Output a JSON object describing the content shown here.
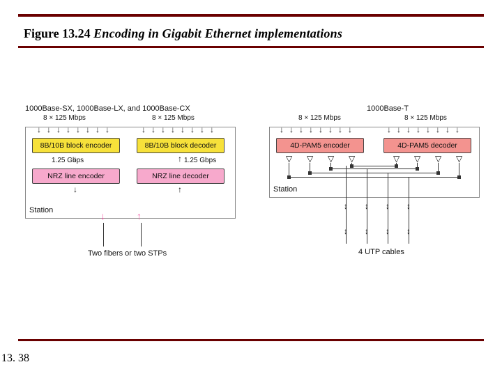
{
  "figure_label": "Figure 13.24",
  "figure_title": " Encoding in Gigabit Ethernet implementations",
  "page_number": "13. 38",
  "left_panel": {
    "header": "1000Base-SX, 1000Base-LX, and 1000Base-CX",
    "top_rate_left": "8 × 125 Mbps",
    "top_rate_right": "8 × 125 Mbps",
    "encoder": "8B/10B block encoder",
    "decoder": "8B/10B block decoder",
    "mid_rate_left": "1.25 Gbps",
    "mid_rate_right": "1.25 Gbps",
    "line_encoder": "NRZ line encoder",
    "line_decoder": "NRZ line decoder",
    "station": "Station",
    "cables": "Two fibers or two STPs"
  },
  "right_panel": {
    "header": "1000Base-T",
    "top_rate_left": "8 × 125 Mbps",
    "top_rate_right": "8 × 125 Mbps",
    "encoder": "4D-PAM5 encoder",
    "decoder": "4D-PAM5 decoder",
    "station": "Station",
    "cables": "4 UTP cables"
  },
  "chart_data": {
    "type": "diagram",
    "title": "Encoding in Gigabit Ethernet implementations",
    "panels": [
      {
        "name": "1000Base-SX / 1000Base-LX / 1000Base-CX",
        "standards": [
          "1000Base-SX",
          "1000Base-LX",
          "1000Base-CX"
        ],
        "parallel_streams": 8,
        "per_stream_rate_Mbps": 125,
        "block_coding": "8B/10B",
        "line_coding": "NRZ",
        "serial_rate_Gbps": 1.25,
        "physical_medium": "Two fibers or two STPs",
        "tx_chain": [
          "8B/10B block encoder",
          "NRZ line encoder"
        ],
        "rx_chain": [
          "NRZ line decoder",
          "8B/10B block decoder"
        ]
      },
      {
        "name": "1000Base-T",
        "standards": [
          "1000Base-T"
        ],
        "parallel_streams": 8,
        "per_stream_rate_Mbps": 125,
        "line_coding": "4D-PAM5",
        "physical_medium": "4 UTP cables",
        "tx_chain": [
          "4D-PAM5 encoder"
        ],
        "rx_chain": [
          "4D-PAM5 decoder"
        ],
        "utp_pairs": 4,
        "full_duplex_per_pair": true
      }
    ]
  }
}
